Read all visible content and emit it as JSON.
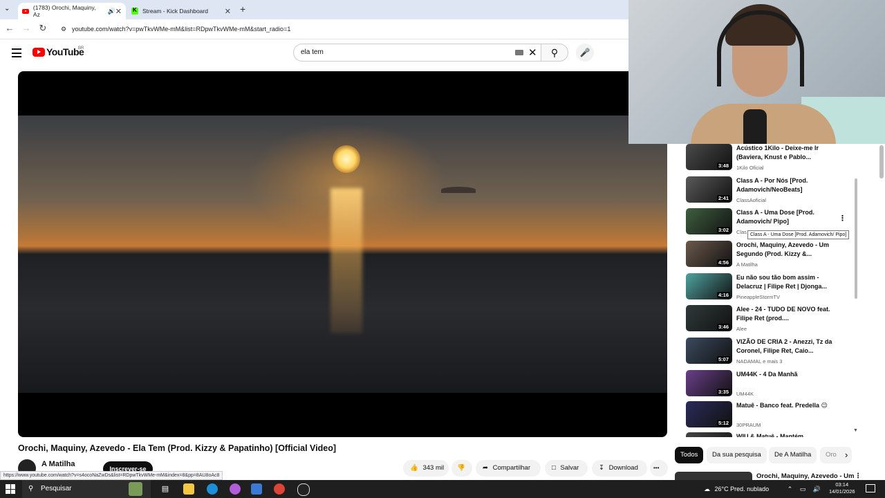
{
  "browser": {
    "tabs": [
      {
        "title": "(1783) Orochi, Maquiny, Az",
        "active": true
      },
      {
        "title": "Stream - Kick Dashboard",
        "active": false
      }
    ],
    "new_tab": "+",
    "url": "youtube.com/watch?v=pwTkvWMe-mM&list=RDpwTkvWMe-mM&start_radio=1",
    "status_url": "https://www.youtube.com/watch?v=s4ocoNaZwDs&list=RDpwTkvWMe-mM&index=8&pp=8AU8oAc8"
  },
  "youtube": {
    "logo_text": "YouTube",
    "region": "BR",
    "search_query": "ela tem"
  },
  "video": {
    "title": "Orochi, Maquiny, Azevedo - Ela Tem (Prod. Kizzy & Papatinho) [Official Video]",
    "channel": "A Matilha",
    "subscribe_label": "Inscrever-se",
    "likes": "343 mil",
    "share_label": "Compartilhar",
    "save_label": "Salvar",
    "download_label": "Download",
    "more_label": "•••"
  },
  "recommendations": [
    {
      "title": "Acústico 1Kilo - Deixe-me Ir (Baviera, Knust e Pablo...",
      "channel": "1Kilo Oficial",
      "duration": "3:48",
      "color": "#4a4a4a"
    },
    {
      "title": "Class A - Por Nós [Prod. Adamovich/NeoBeats]",
      "channel": "ClassAoficial",
      "duration": "2:41",
      "color": "#5a5a5a"
    },
    {
      "title": "Class A - Uma Dose [Prod. Adamovich/ Pipo]",
      "channel": "Clas",
      "duration": "3:02",
      "color": "#3f5f3f"
    },
    {
      "title": "Orochi, Maquiny, Azevedo - Um Segundo (Prod. Kizzy &...",
      "channel": "A Matilha",
      "duration": "4:56",
      "color": "#6b5a4c"
    },
    {
      "title": "Eu não sou tão bom assim - Delacruz | Filipe Ret | Djonga...",
      "channel": "PineappleStormTV",
      "duration": "4:16",
      "color": "#4fa3a0"
    },
    {
      "title": "Alee - 24 - TUDO DE NOVO feat. Filipe Ret (prod....",
      "channel": "Alee",
      "duration": "3:46",
      "color": "#2f3a3a"
    },
    {
      "title": "VIZÃO DE CRIA 2 - Anezzi, Tz da Coronel, Filipe Ret, Caio...",
      "channel": "NADAMAL e mais 3",
      "duration": "5:07",
      "color": "#3b4b5e"
    },
    {
      "title": "UM44K - 4 Da Manhã",
      "channel": "UM44K",
      "duration": "3:35",
      "color": "#6b3f8a"
    },
    {
      "title": "Matuê - Banco feat. Predella 😉",
      "channel": "30PRAUM",
      "duration": "5:12",
      "color": "#2b2b5a"
    },
    {
      "title": "WIU & Matuê - Mantém",
      "channel": "",
      "duration": "",
      "color": "#444"
    }
  ],
  "tooltip": "Class A - Uma Dose [Prod. Adamovich/ Pipo]",
  "chips": [
    "Todos",
    "Da sua pesquisa",
    "De A Matilha",
    "Oro"
  ],
  "bottom_rec_title": "Orochi, Maquiny, Azevedo - Um",
  "taskbar": {
    "search_placeholder": "Pesquisar",
    "weather": "26°C  Pred. nublado",
    "time": "03:14",
    "date": "14/01/2026"
  }
}
